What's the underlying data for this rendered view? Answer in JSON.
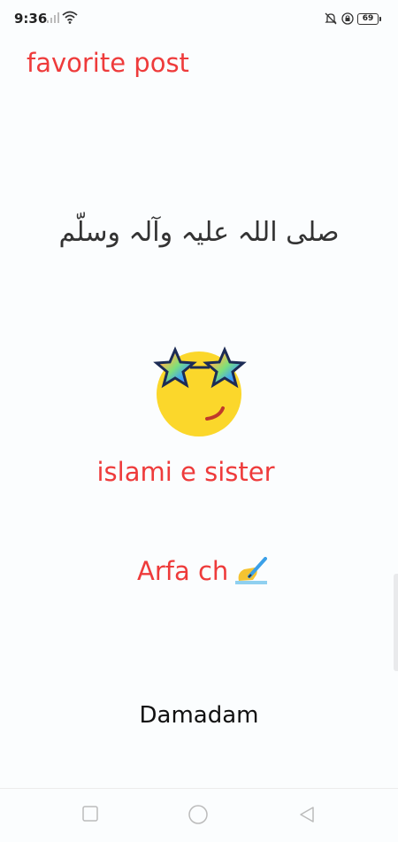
{
  "status_bar": {
    "time": "9:36",
    "battery": "69"
  },
  "header": {
    "title": "favorite post"
  },
  "post": {
    "arabic_text": "صلى اللہ علیہ وآلہ وسلّم",
    "line1": "islami e sister",
    "line2": "Arfa ch",
    "footer": "Damadam"
  },
  "icons": {
    "emoji": "star-glasses-emoji-icon",
    "writing_hand": "writing-hand-icon"
  },
  "colors": {
    "accent": "#ee3b3b",
    "text": "#333333",
    "background": "#fbfdfe"
  }
}
